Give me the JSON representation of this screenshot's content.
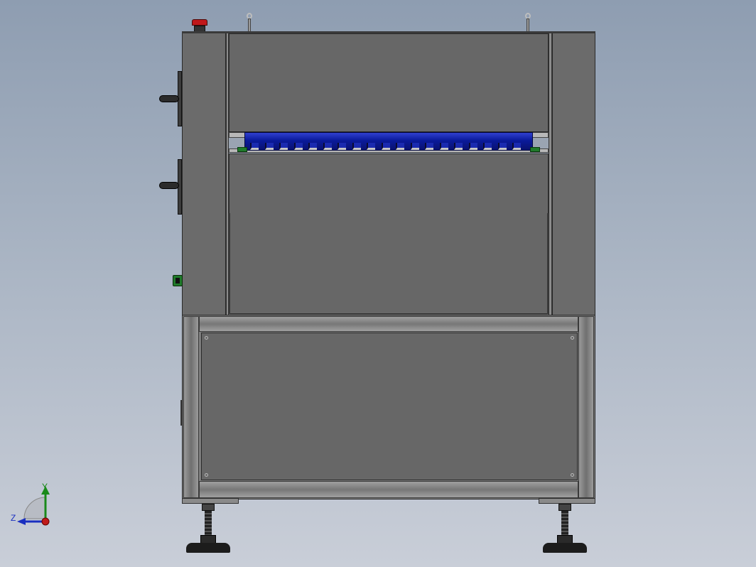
{
  "viewport": {
    "background_top": "#8e9db1",
    "background_bottom": "#c9ced8"
  },
  "machine": {
    "body_color": "#676767",
    "edge_color": "#2a2a2a",
    "frame_color": "#8a8a8a",
    "conveyor_color": "#0a1a9a",
    "estop_color": "#c0181b",
    "indicator_color": "#1f7a2a",
    "conveyor_rollers": 19
  },
  "triad": {
    "y_label": "Y",
    "z_label": "Z",
    "y_color": "#1a8a1a",
    "z_color": "#1a2fc0",
    "x_color": "#c01a1a"
  },
  "icons": {
    "estop": "emergency-stop-icon",
    "lift_eye": "lifting-eye-icon",
    "knob": "control-knob-icon",
    "foot": "leveling-foot-icon",
    "triad": "view-orientation-icon"
  }
}
